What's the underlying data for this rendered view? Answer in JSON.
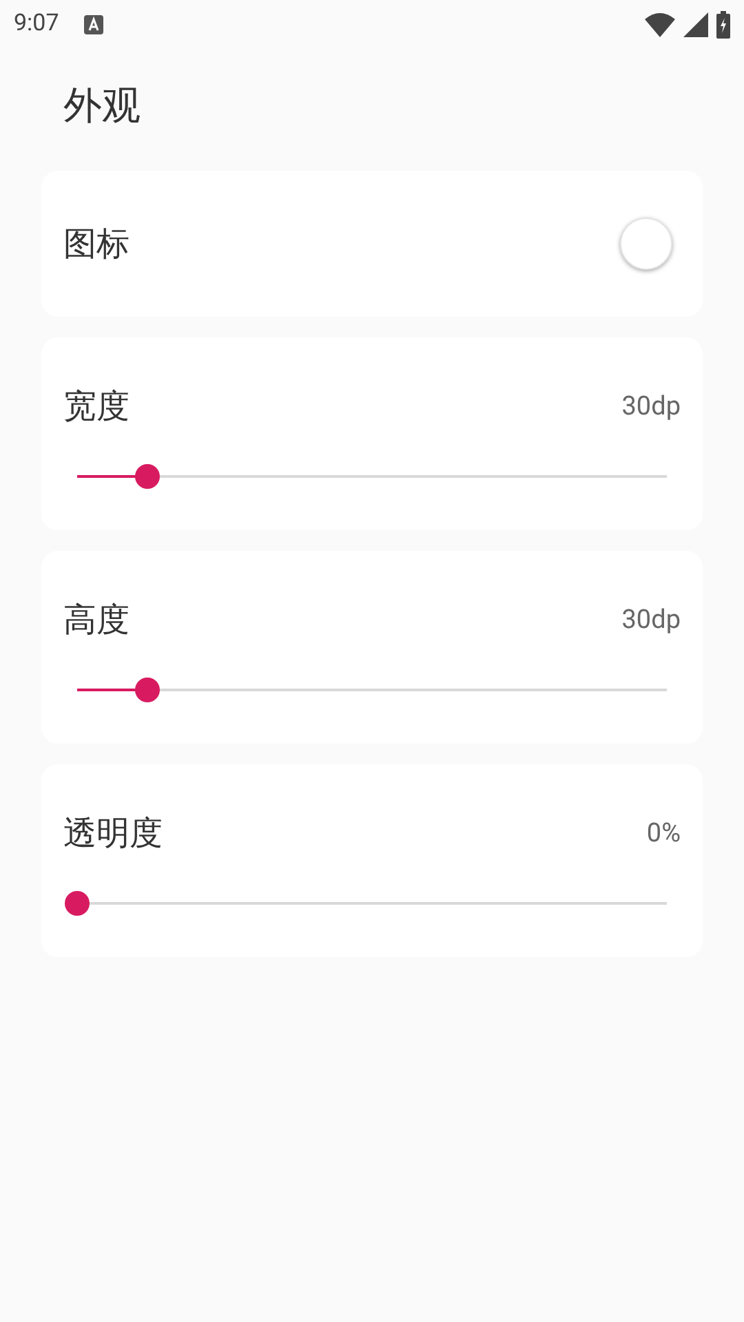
{
  "status_bar": {
    "time": "9:07"
  },
  "title": "外观",
  "settings": [
    {
      "kind": "switch",
      "label": "图标",
      "on": false
    },
    {
      "kind": "slider",
      "label": "宽度",
      "reading": "30dp",
      "level": 0.12
    },
    {
      "kind": "slider",
      "label": "高度",
      "reading": "30dp",
      "level": 0.12
    },
    {
      "kind": "slider",
      "label": "透明度",
      "reading": "0%",
      "level": 0
    }
  ]
}
